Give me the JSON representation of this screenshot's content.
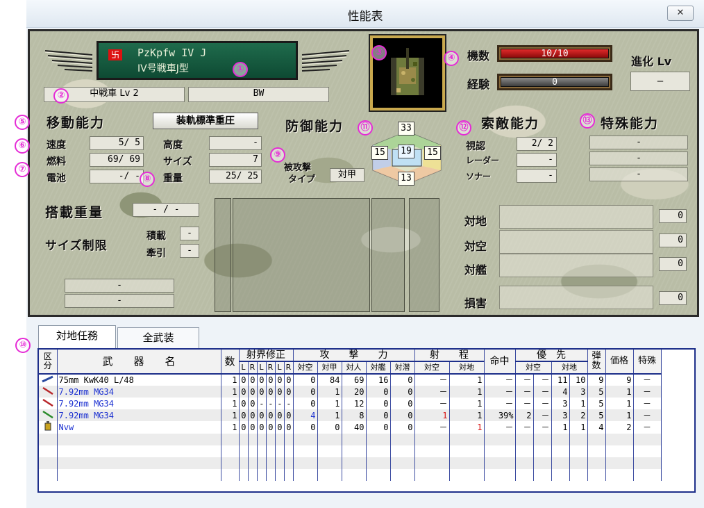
{
  "window": {
    "title": "性能表",
    "close_glyph": "✕"
  },
  "unit": {
    "flag_glyph": "卐",
    "name_en": "PzKpfw IV J",
    "name_jp": "IV号戦車J型",
    "class": "中戦車 Lv 2",
    "nation": "BW",
    "count_label": "機数",
    "count_value": "10/10",
    "exp_label": "経験",
    "exp_value": "0",
    "evo_label": "進化 Lv",
    "evo_value": "—"
  },
  "badges": [
    "①",
    "②",
    "③",
    "④",
    "⑤",
    "⑥",
    "⑦",
    "⑧",
    "⑨",
    "⑩",
    "⑪",
    "⑫",
    "⑬"
  ],
  "mobility": {
    "title": "移動能力",
    "style_button": "装軌標準重圧",
    "speed_label": "速度",
    "speed": "5/ 5",
    "fuel_label": "燃料",
    "fuel": "69/ 69",
    "battery_label": "電池",
    "battery": "-/ -",
    "altitude_label": "高度",
    "altitude": "-",
    "size_label": "サイズ",
    "size": "7",
    "weight_label": "重量",
    "weight": "25/ 25"
  },
  "defense": {
    "title": "防御能力",
    "attack_type_label_1": "被攻撃",
    "attack_type_label_2": "タイプ",
    "attack_type": "対甲",
    "armor_front": "33",
    "armor_center": "19",
    "armor_left": "15",
    "armor_right": "15",
    "armor_rear": "13"
  },
  "search": {
    "title": "索敵能力",
    "visual_label": "視認",
    "visual": "2/ 2",
    "radar_label": "レーダー",
    "radar": "-",
    "sonar_label": "ソナー",
    "sonar": "-"
  },
  "special": {
    "title": "特殊能力",
    "v1": "-",
    "v2": "-",
    "v3": "-"
  },
  "load": {
    "weight_label": "搭載重量",
    "weight": "- / -",
    "size_label": "サイズ制限",
    "carry_label": "積載",
    "carry": "-",
    "tow_label": "牽引",
    "tow": "-",
    "box1": "-",
    "box2": "-"
  },
  "attack_summary": {
    "ground_label": "対地",
    "ground": "0",
    "air_label": "対空",
    "air": "0",
    "ship_label": "対艦",
    "ship": "0",
    "damage_label": "損害",
    "damage": "0"
  },
  "tabs": [
    "対地任務",
    "全武装"
  ],
  "table": {
    "headers": {
      "kubun": "区分",
      "weapon": "武　　器　　名",
      "count": "数",
      "arc": "射界修正",
      "arc_sub": [
        "L",
        "R",
        "L",
        "R",
        "L",
        "R"
      ],
      "attack": "攻　　撃　　力",
      "attack_sub": [
        "対空",
        "対甲",
        "対人",
        "対艦",
        "対潜"
      ],
      "range": "射　　程",
      "range_sub": [
        "対空",
        "対地"
      ],
      "hit": "命中",
      "priority": "優　先",
      "priority_sub": [
        "対空",
        "対地"
      ],
      "ammo": "弾数",
      "price": "価格",
      "special": "特殊"
    },
    "rows": [
      {
        "icon": "cannon-icon",
        "name": "75mm KwK40 L/48",
        "color": "#000000",
        "count": "1",
        "arc": [
          "0",
          "0",
          "0",
          "0",
          "0",
          "0"
        ],
        "atk": [
          "0",
          "84",
          "69",
          "16",
          "0"
        ],
        "rng": [
          "－",
          "1"
        ],
        "hit": "－",
        "pri": [
          "－",
          "－",
          "11",
          "10"
        ],
        "ammo": "9",
        "price": "9",
        "special": "－"
      },
      {
        "icon": "mg-icon",
        "name": "7.92mm MG34",
        "color": "#1a2fd0",
        "count": "1",
        "arc": [
          "0",
          "0",
          "0",
          "0",
          "0",
          "0"
        ],
        "atk": [
          "0",
          "1",
          "20",
          "0",
          "0"
        ],
        "rng": [
          "－",
          "1"
        ],
        "hit": "－",
        "pri": [
          "－",
          "－",
          "4",
          "3"
        ],
        "ammo": "5",
        "price": "1",
        "special": "－"
      },
      {
        "icon": "mg-icon",
        "name": "7.92mm MG34",
        "color": "#1a2fd0",
        "count": "1",
        "arc": [
          "0",
          "0",
          "-",
          "-",
          "-",
          "-"
        ],
        "atk": [
          "0",
          "1",
          "12",
          "0",
          "0"
        ],
        "rng": [
          "－",
          "1"
        ],
        "hit": "－",
        "pri": [
          "－",
          "－",
          "3",
          "1"
        ],
        "ammo": "5",
        "price": "1",
        "special": "－"
      },
      {
        "icon": "aa-mg-icon",
        "name": "7.92mm MG34",
        "color": "#1a2fd0",
        "count": "1",
        "arc": [
          "0",
          "0",
          "0",
          "0",
          "0",
          "0"
        ],
        "atk": [
          "4",
          "1",
          "8",
          "0",
          "0"
        ],
        "rng": [
          "1",
          "1"
        ],
        "hit": "39%",
        "pri": [
          "2",
          "－",
          "3",
          "2"
        ],
        "ammo": "5",
        "price": "1",
        "special": "－"
      },
      {
        "icon": "grenade-icon",
        "name": "Nvw",
        "color": "#1a2fd0",
        "count": "1",
        "arc": [
          "0",
          "0",
          "0",
          "0",
          "0",
          "0"
        ],
        "atk": [
          "0",
          "0",
          "40",
          "0",
          "0"
        ],
        "rng": [
          "－",
          "1"
        ],
        "hit": "－",
        "pri": [
          "－",
          "－",
          "1",
          "1"
        ],
        "ammo": "4",
        "price": "2",
        "special": "－"
      }
    ]
  },
  "colors": {
    "accent_badge": "#e52bd6",
    "table_border": "#1d2f8a",
    "name_box": "#1f6b4c",
    "count_bar": "#b40d0d",
    "exp_bar": "#5a5a5a"
  }
}
